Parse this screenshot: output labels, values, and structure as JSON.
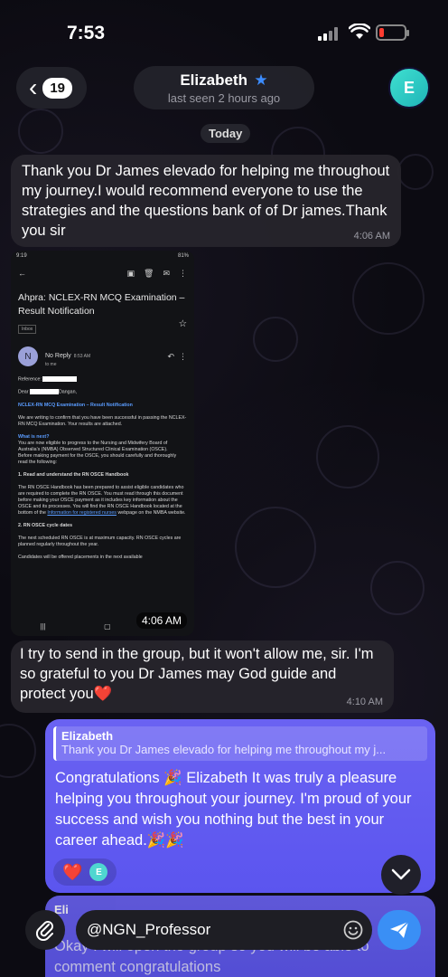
{
  "status_bar": {
    "time": "7:53"
  },
  "header": {
    "back_count": "19",
    "contact_name": "Elizabeth",
    "last_seen": "last seen 2 hours ago",
    "avatar_initial": "E"
  },
  "date_divider": "Today",
  "messages": {
    "incoming_1": {
      "text": "Thank you Dr James elevado for helping me throughout my journey.I would recommend everyone to use the strategies and the questions bank of of Dr james.Thank you sir",
      "time": "4:06 AM"
    },
    "photo": {
      "time": "4:06 AM",
      "screenshot": {
        "status_time": "9:19",
        "battery": "81%",
        "subject": "Ahpra: NCLEX-RN MCQ Examination – Result Notification",
        "inbox_label": "Inbox",
        "sender_initial": "N",
        "sender_name": "No Reply",
        "sender_time": "8:53 AM",
        "to": "to me",
        "reference_label": "Reference:",
        "dear_label": "Dear",
        "dear_suffix": "Dangan,",
        "heading": "NCLEX-RN MCQ Examination – Result Notification",
        "p1": "We are writing to confirm that you have been successful in passing the NCLEX-RN MCQ Examination. Your results are attached.",
        "whats_next": "What is next?",
        "p2": "You are now eligible to progress to the Nursing and Midwifery Board of Australia's (NMBA) Observed Structured Clinical Examination (OSCE).",
        "p3": "Before making payment for the OSCE, you should carefully and thoroughly read the following:",
        "item1": "1.   Read and understand the RN OSCE Handbook",
        "p4": "The RN OSCE Handbook has been prepared to assist eligible candidates who are required to complete the RN OSCE. You must read through this document before making your OSCE payment as it includes key information about the OSCE and its processes.  You will find the RN OSCE Handbook located at the bottom of the",
        "p4_link": "Information for registered nurses",
        "p4_tail": "webpage on the NMBA website.",
        "item2": "2.   RN OSCE cycle dates",
        "p5": "The next scheduled RN OSCE is at maximum capacity. RN OSCE cycles are planned regularly throughout the year.",
        "p6": "Candidates will be offered placements in the next available"
      }
    },
    "incoming_2": {
      "text": "I try to send in the group, but it won't allow me, sir. I'm so grateful to you Dr James may God guide and protect you❤️",
      "time": "4:10 AM"
    },
    "outgoing_1": {
      "reply_name": "Elizabeth",
      "reply_text": "Thank you Dr James elevado for helping me throughout my j...",
      "text": "Congratulations 🎉 Elizabeth It was truly a pleasure helping you throughout your journey. I'm proud of your success and wish you nothing but the best in your career ahead.🎉🎉",
      "reaction_emoji": "❤️",
      "reaction_initial": "E"
    },
    "outgoing_2": {
      "reply_name": "Eli",
      "text": "Okay I will open the group so you will be able to comment congratulations"
    }
  },
  "input": {
    "value": "@NGN_Professor"
  },
  "colors": {
    "outgoing_bubble": "#5f5af0",
    "incoming_bubble": "#26242c",
    "send_button": "#3a8ff5",
    "verified_star": "#3c8cff",
    "avatar": "#2ec7c3"
  }
}
